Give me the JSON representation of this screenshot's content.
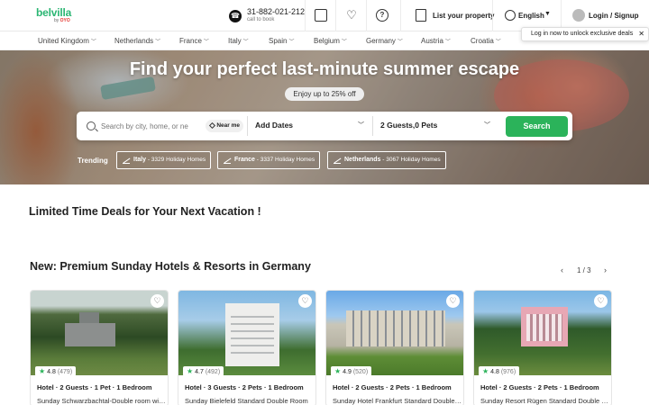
{
  "header": {
    "brand": "belvilla",
    "brand_sub_prefix": "by",
    "brand_sub_name": "OYO",
    "phone_number": "31-882-021-212",
    "phone_cta": "call to book",
    "list_property": "List your property",
    "language": "English",
    "login": "Login / Signup",
    "colors": {
      "brand": "#2bb673",
      "accent": "#2bb35a"
    }
  },
  "countries": [
    "United Kingdom",
    "Netherlands",
    "France",
    "Italy",
    "Spain",
    "Belgium",
    "Germany",
    "Austria",
    "Croatia"
  ],
  "tooltip": "Log in now to unlock exclusive deals",
  "hero": {
    "title": "Find your perfect last-minute summer escape",
    "promo": "Enjoy up to 25% off",
    "search": {
      "placeholder": "Search by city, home, or ne",
      "near_me": "Near me",
      "dates": "Add Dates",
      "guests": "2 Guests,0 Pets",
      "button": "Search"
    },
    "trending_label": "Trending",
    "trending": [
      {
        "place": "Italy",
        "count": "- 3329 Holiday Homes"
      },
      {
        "place": "France",
        "count": "- 3337 Holiday Homes"
      },
      {
        "place": "Netherlands",
        "count": "- 3067 Holiday Homes"
      }
    ]
  },
  "deals": {
    "title": "Limited Time Deals for Your Next Vacation !"
  },
  "premium": {
    "title": "New: Premium Sunday Hotels & Resorts in Germany",
    "page": "1 / 3",
    "cards": [
      {
        "rating": "4.8",
        "reviews": "(479)",
        "info": "Hotel · 2 Guests · 1 Pet · 1 Bedroom",
        "name": "Sunday Schwarzbachtal-Double room with terrace"
      },
      {
        "rating": "4.7",
        "reviews": "(492)",
        "info": "Hotel · 3 Guests · 2 Pets · 1 Bedroom",
        "name": "Sunday Bielefeld Standard Double Room"
      },
      {
        "rating": "4.9",
        "reviews": "(520)",
        "info": "Hotel · 2 Guests · 2 Pets · 1 Bedroom",
        "name": "Sunday Hotel Frankfurt Standard Double Room"
      },
      {
        "rating": "4.8",
        "reviews": "(976)",
        "info": "Hotel · 2 Guests · 2 Pets · 1 Bedroom",
        "name": "Sunday Resort Rügen Standard Double Room"
      }
    ]
  }
}
